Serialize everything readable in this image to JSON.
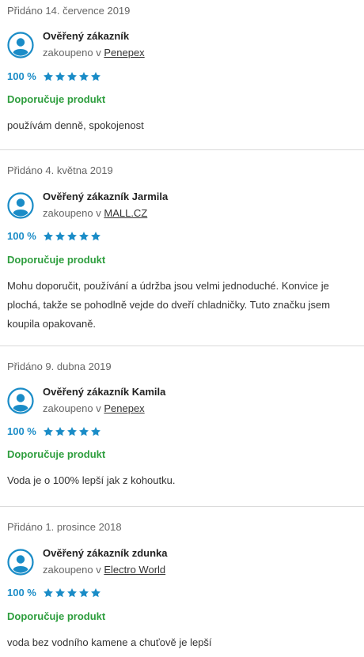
{
  "reviews": [
    {
      "date": "Přidáno 14. července 2019",
      "author": "Ověřený zákazník",
      "bought_prefix": "zakoupeno v",
      "shop": "Penepex",
      "percent": "100 %",
      "stars": 5,
      "recommend": "Doporučuje produkt",
      "text": "používám denně, spokojenost"
    },
    {
      "date": "Přidáno 4. května 2019",
      "author": "Ověřený zákazník Jarmila",
      "bought_prefix": "zakoupeno v",
      "shop": "MALL.CZ",
      "percent": "100 %",
      "stars": 5,
      "recommend": "Doporučuje produkt",
      "text": "Mohu doporučit, používání a údržba jsou velmi jednoduché. Konvice je plochá, takže se pohodlně vejde do dveří chladničky. Tuto značku jsem koupila opakovaně."
    },
    {
      "date": "Přidáno 9. dubna 2019",
      "author": "Ověřený zákazník Kamila",
      "bought_prefix": "zakoupeno v",
      "shop": "Penepex",
      "percent": "100 %",
      "stars": 5,
      "recommend": "Doporučuje produkt",
      "text": "Voda je o 100% lepší jak z kohoutku."
    },
    {
      "date": "Přidáno 1. prosince 2018",
      "author": "Ověřený zákazník zdunka",
      "bought_prefix": "zakoupeno v",
      "shop": "Electro World",
      "percent": "100 %",
      "stars": 5,
      "recommend": "Doporučuje produkt",
      "text": "voda bez vodního kamene a chuťově je lepší"
    }
  ],
  "colors": {
    "accent": "#1a8cc7",
    "recommend": "#2e9e3e"
  },
  "icons": {
    "avatar": "user-avatar-icon",
    "star": "star-icon"
  }
}
